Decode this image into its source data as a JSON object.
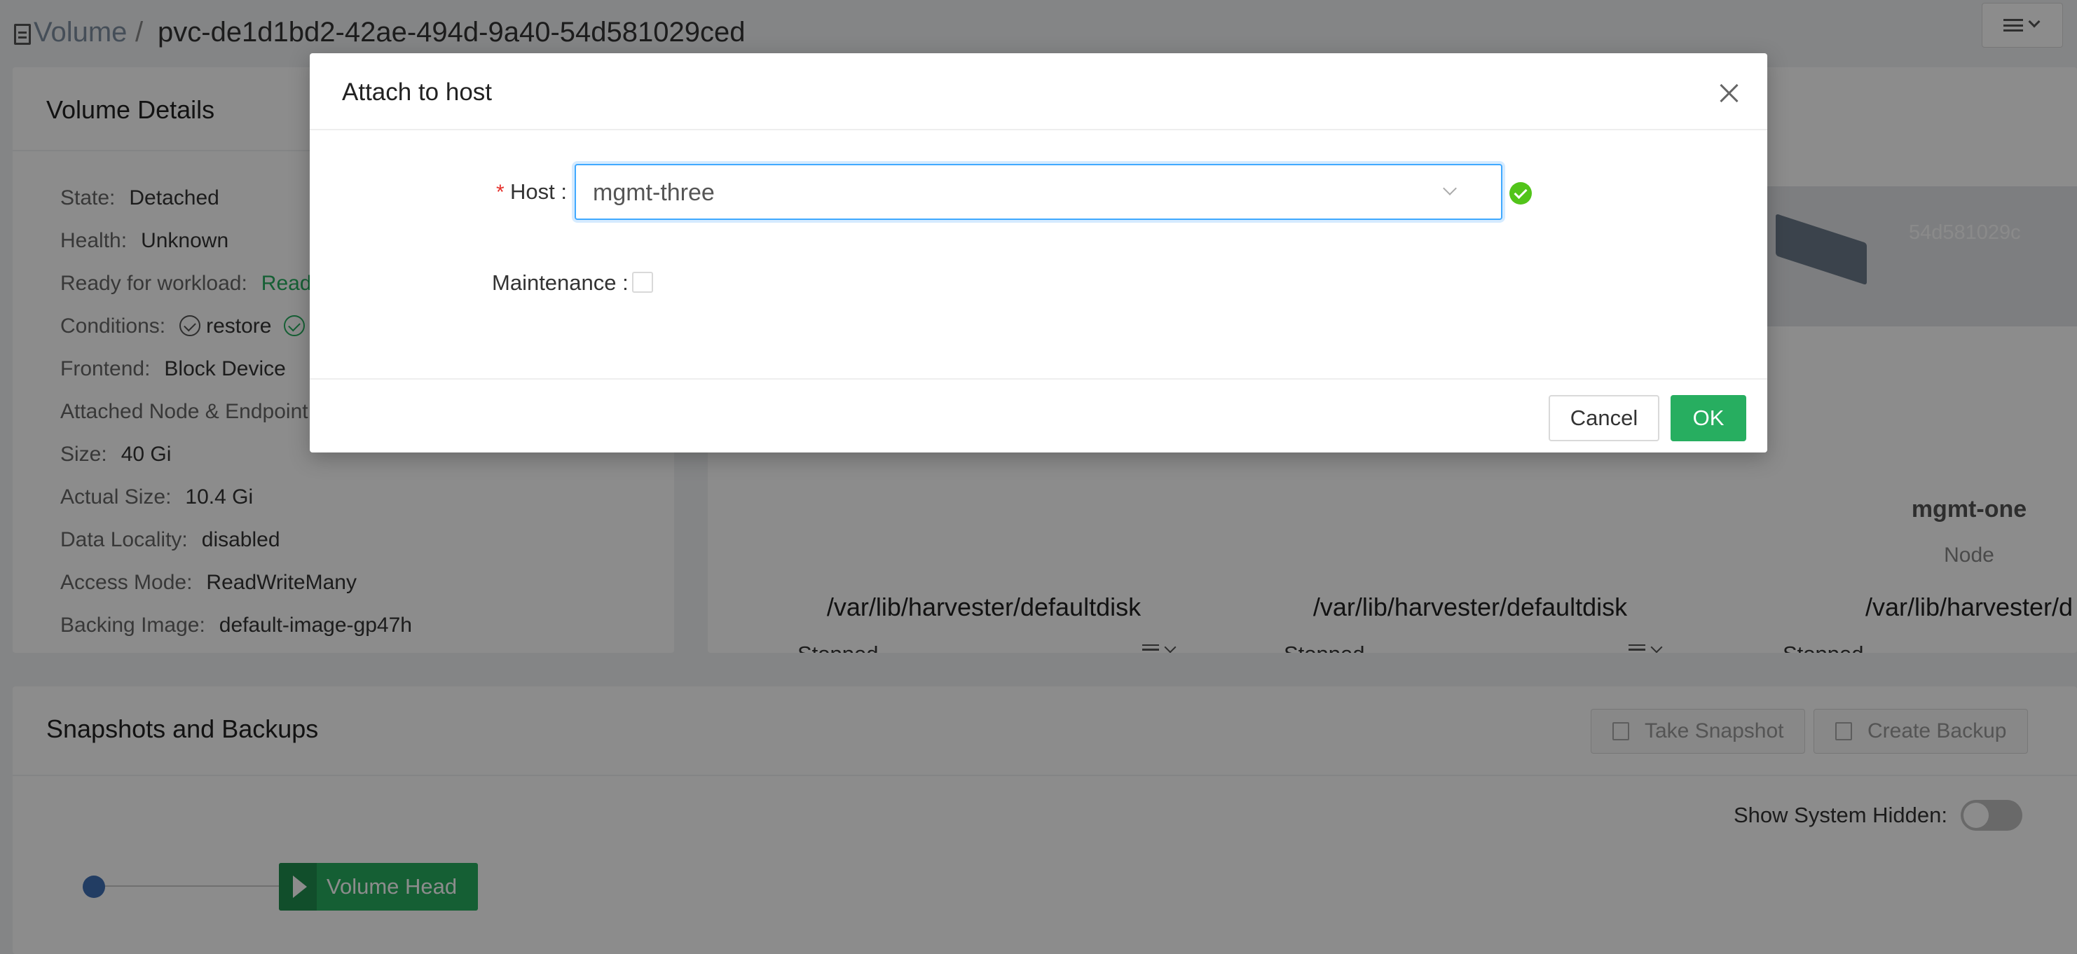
{
  "breadcrumb": {
    "root": "Volume",
    "separator": "/",
    "leaf": "pvc-de1d1bd2-42ae-494d-9a40-54d581029ced"
  },
  "details": {
    "title": "Volume Details",
    "rows": [
      {
        "label": "State:",
        "value": "Detached"
      },
      {
        "label": "Health:",
        "value": "Unknown"
      },
      {
        "label": "Ready for workload:",
        "value": "Read"
      },
      {
        "label": "Conditions:",
        "value": "restore"
      },
      {
        "label": "Frontend:",
        "value": "Block Device"
      },
      {
        "label": "Attached Node & Endpoint",
        "value": ""
      },
      {
        "label": "Size:",
        "value": "40 Gi"
      },
      {
        "label": "Actual Size:",
        "value": "10.4 Gi"
      },
      {
        "label": "Data Locality:",
        "value": "disabled"
      },
      {
        "label": "Access Mode:",
        "value": "ReadWriteMany"
      },
      {
        "label": "Backing Image:",
        "value": "default-image-gp47h"
      }
    ]
  },
  "replicas": [
    {
      "path": "/var/lib/harvester/defaultdisk",
      "status": "Stopped"
    },
    {
      "path": "/var/lib/harvester/defaultdisk",
      "status": "Stopped"
    },
    {
      "node": "mgmt-one",
      "role": "Node",
      "path": "/var/lib/harvester/d",
      "status": "Stopped",
      "id": "54d581029c"
    }
  ],
  "snapshots": {
    "title": "Snapshots and Backups",
    "take_snapshot": "Take Snapshot",
    "create_backup": "Create Backup",
    "show_hidden_label": "Show System Hidden:",
    "show_hidden_on": false,
    "volume_head": "Volume Head"
  },
  "modal": {
    "title": "Attach to host",
    "host_label": "Host",
    "host_value": "mgmt-three",
    "maintenance_label": "Maintenance",
    "maintenance_checked": false,
    "cancel_label": "Cancel",
    "ok_label": "OK"
  },
  "colors": {
    "accent_green": "#27ae60",
    "focus_blue": "#40a9ff",
    "required_red": "#e5322d"
  }
}
